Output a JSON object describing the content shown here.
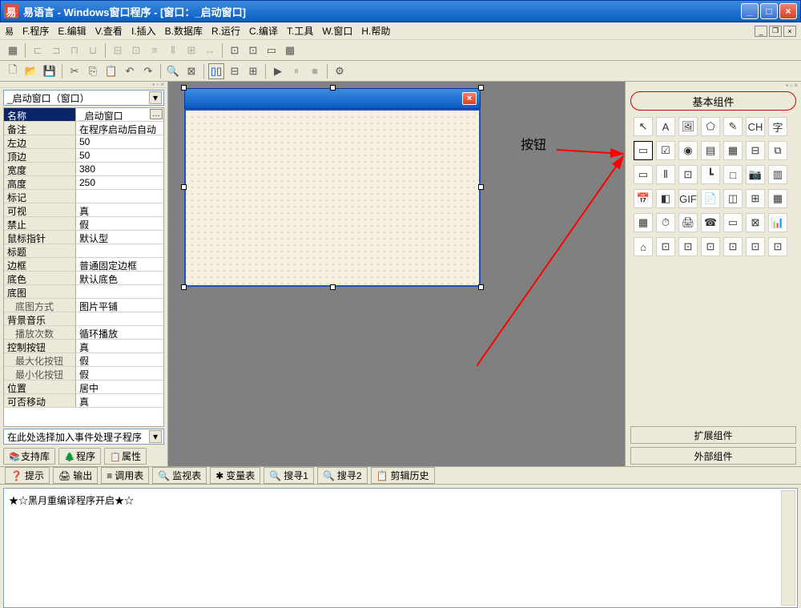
{
  "title": "易语言 - Windows窗口程序 - [窗口：_启动窗口]",
  "menus": [
    "F.程序",
    "E.编辑",
    "V.查看",
    "I.插入",
    "B.数据库",
    "R.运行",
    "C.编译",
    "T.工具",
    "W.窗口",
    "H.帮助"
  ],
  "combo_window": "_启动窗口（窗口）",
  "properties": [
    {
      "k": "名称",
      "v": "_启动窗口",
      "sel": true,
      "btn": true
    },
    {
      "k": "备注",
      "v": "在程序启动后自动"
    },
    {
      "k": "左边",
      "v": "50"
    },
    {
      "k": "顶边",
      "v": "50"
    },
    {
      "k": "宽度",
      "v": "380"
    },
    {
      "k": "高度",
      "v": "250"
    },
    {
      "k": "标记",
      "v": ""
    },
    {
      "k": "可视",
      "v": "真"
    },
    {
      "k": "禁止",
      "v": "假"
    },
    {
      "k": "鼠标指针",
      "v": "默认型"
    },
    {
      "k": "标题",
      "v": ""
    },
    {
      "k": "边框",
      "v": "普通固定边框"
    },
    {
      "k": "底色",
      "v": "默认底色"
    },
    {
      "k": "底图",
      "v": ""
    },
    {
      "k": "底图方式",
      "v": "图片平铺",
      "indent": true
    },
    {
      "k": "背景音乐",
      "v": ""
    },
    {
      "k": "播放次数",
      "v": "循环播放",
      "indent": true
    },
    {
      "k": "控制按钮",
      "v": "真"
    },
    {
      "k": "最大化按钮",
      "v": "假",
      "indent": true
    },
    {
      "k": "最小化按钮",
      "v": "假",
      "indent": true
    },
    {
      "k": "位置",
      "v": "居中"
    },
    {
      "k": "可否移动",
      "v": "真"
    }
  ],
  "event_combo": "在此处选择加入事件处理子程序",
  "left_tabs": [
    "支持库",
    "程序",
    "属性"
  ],
  "right_panel": {
    "header": "基本组件",
    "btn1": "扩展组件",
    "btn2": "外部组件"
  },
  "annotation": "按钮",
  "bottom_tabs": [
    "提示",
    "输出",
    "调用表",
    "监视表",
    "变量表",
    "搜寻1",
    "搜寻2",
    "剪辑历史"
  ],
  "bottom_content": "★☆黑月重编译程序开启★☆",
  "palette_icons": [
    "↖",
    "A",
    "🖼",
    "⬠",
    "✎",
    "CH",
    "字",
    "▭",
    "☑",
    "◉",
    "▤",
    "▦",
    "⊟",
    "⧉",
    "▭",
    "⫴",
    "⊡",
    "┗",
    "□",
    "📷",
    "▥",
    "📅",
    "◧",
    "GIF",
    "📄",
    "◫",
    "⊞",
    "▦",
    "▦",
    "⏱",
    "🖨",
    "☎",
    "▭",
    "⊠",
    "📊",
    "⌂",
    "⊡",
    "⊡",
    "⊡",
    "⊡",
    "⊡",
    "⊡"
  ]
}
